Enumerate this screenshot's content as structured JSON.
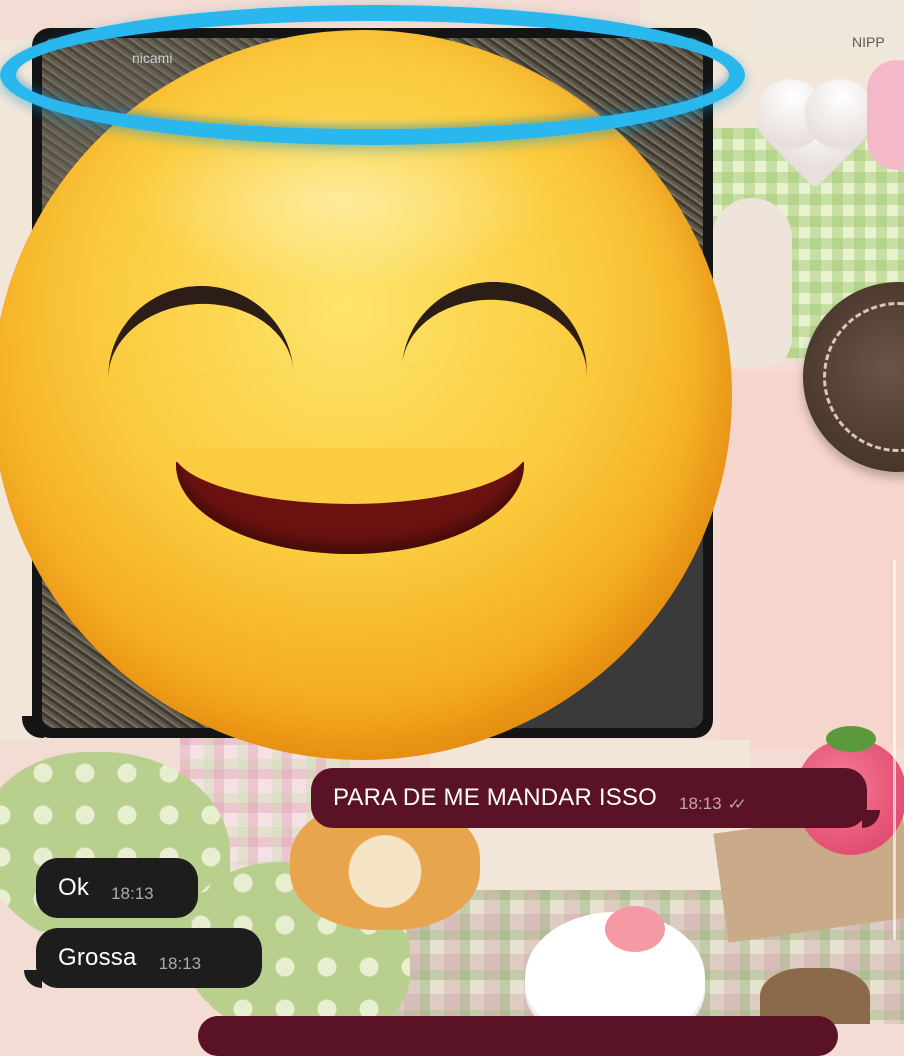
{
  "media_message": {
    "caption": "nicami"
  },
  "messages": [
    {
      "direction": "outgoing",
      "text": "PARA DE ME MANDAR ISSO",
      "time": "18:13",
      "status": "read"
    },
    {
      "direction": "incoming",
      "text": "Ok",
      "time": "18:13"
    },
    {
      "direction": "incoming",
      "text": "Grossa",
      "time": "18:13"
    }
  ],
  "sticker": {
    "icon": "smiling-face-with-halo-emoji"
  },
  "wallpaper": {
    "stamp_text": "NIPP"
  },
  "colors": {
    "outgoing_bubble": "#5a1326",
    "incoming_bubble": "#1d1d1d"
  }
}
